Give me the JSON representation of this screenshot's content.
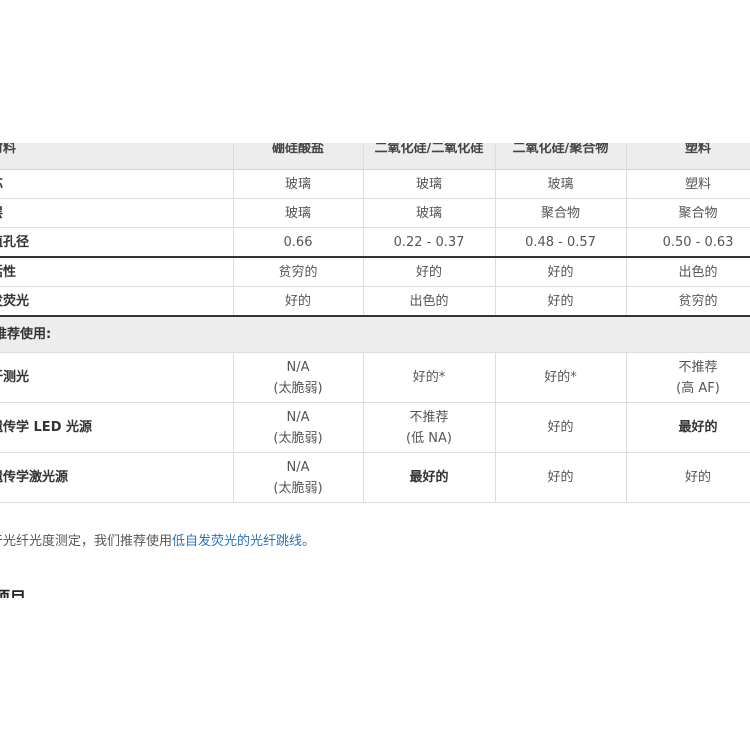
{
  "table": {
    "header": [
      "材料",
      "硼硅酸盐",
      "二氧化硅/二氧化硅",
      "二氧化硅/聚合物",
      "塑料"
    ],
    "rows": [
      {
        "label": "芯",
        "values": [
          "玻璃",
          "玻璃",
          "玻璃",
          "塑料"
        ]
      },
      {
        "label": "层",
        "values": [
          "玻璃",
          "玻璃",
          "聚合物",
          "聚合物"
        ]
      },
      {
        "label": "值孔径",
        "values": [
          "0.66",
          "0.22 - 0.37",
          "0.48 - 0.57",
          "0.50 - 0.63"
        ]
      },
      {
        "label": "活性",
        "values": [
          "贫穷的",
          "好的",
          "好的",
          "出色的"
        ]
      },
      {
        "label": "发荧光",
        "values": [
          "好的",
          "出色的",
          "好的",
          "贫穷的"
        ]
      }
    ],
    "section_label": "推荐使用:",
    "usage_rows": [
      {
        "label": "纤测光",
        "values": [
          {
            "line1": "N/A",
            "line2": "(太脆弱)",
            "bold": false
          },
          {
            "line1": "好的*",
            "line2": "",
            "bold": false
          },
          {
            "line1": "好的*",
            "line2": "",
            "bold": false
          },
          {
            "line1": "不推荐",
            "line2": "(高 AF)",
            "bold": false
          }
        ]
      },
      {
        "label": "遗传学 LED 光源",
        "values": [
          {
            "line1": "N/A",
            "line2": "(太脆弱)",
            "bold": false
          },
          {
            "line1": "不推荐",
            "line2": "(低 NA)",
            "bold": false
          },
          {
            "line1": "好的",
            "line2": "",
            "bold": false
          },
          {
            "line1": "最好的",
            "line2": "",
            "bold": true
          }
        ]
      },
      {
        "label": "遗传学激光源",
        "values": [
          {
            "line1": "N/A",
            "line2": "(太脆弱)",
            "bold": false
          },
          {
            "line1": "最好的",
            "line2": "",
            "bold": true
          },
          {
            "line1": "好的",
            "line2": "",
            "bold": false
          },
          {
            "line1": "好的",
            "line2": "",
            "bold": false
          }
        ]
      }
    ]
  },
  "note": {
    "prefix": "于光纤光度测定，我们推荐使用",
    "link": "低自发荧光的光纤跳线",
    "suffix": "。"
  },
  "next_heading": "项目",
  "colors": {
    "header_bg": "#ededed",
    "link": "#2a73b8",
    "border": "#dcdcdc",
    "rule": "#333333"
  }
}
